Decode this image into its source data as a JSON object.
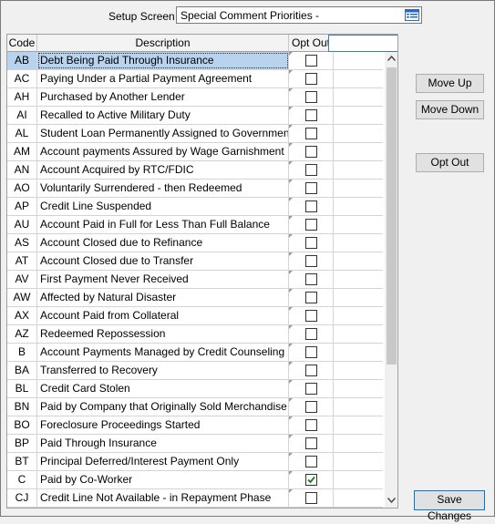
{
  "setup": {
    "label": "Setup Screen",
    "value": "Special Comment Priorities -"
  },
  "grid": {
    "headers": {
      "code": "Code",
      "description": "Description",
      "opt_out": "Opt Out"
    },
    "rows": [
      {
        "code": "AB",
        "description": "Debt Being Paid Through Insurance",
        "opt_out": false,
        "selected": true
      },
      {
        "code": "AC",
        "description": "Paying Under a Partial Payment Agreement",
        "opt_out": false
      },
      {
        "code": "AH",
        "description": "Purchased by Another Lender",
        "opt_out": false
      },
      {
        "code": "AI",
        "description": "Recalled to Active Military Duty",
        "opt_out": false
      },
      {
        "code": "AL",
        "description": "Student Loan Permanently Assigned to Government",
        "opt_out": false
      },
      {
        "code": "AM",
        "description": "Account payments Assured by Wage Garnishment",
        "opt_out": false
      },
      {
        "code": "AN",
        "description": "Account Acquired by RTC/FDIC",
        "opt_out": false
      },
      {
        "code": "AO",
        "description": "Voluntarily Surrendered - then Redeemed",
        "opt_out": false
      },
      {
        "code": "AP",
        "description": "Credit Line Suspended",
        "opt_out": false
      },
      {
        "code": "AU",
        "description": "Account Paid in Full for Less Than Full Balance",
        "opt_out": false
      },
      {
        "code": "AS",
        "description": "Account Closed due to Refinance",
        "opt_out": false
      },
      {
        "code": "AT",
        "description": "Account Closed due to Transfer",
        "opt_out": false
      },
      {
        "code": "AV",
        "description": "First Payment Never Received",
        "opt_out": false
      },
      {
        "code": "AW",
        "description": "Affected by Natural Disaster",
        "opt_out": false
      },
      {
        "code": "AX",
        "description": "Account Paid from Collateral",
        "opt_out": false
      },
      {
        "code": "AZ",
        "description": "Redeemed Repossession",
        "opt_out": false
      },
      {
        "code": "B",
        "description": "Account Payments Managed by Credit Counseling",
        "opt_out": false
      },
      {
        "code": "BA",
        "description": "Transferred to Recovery",
        "opt_out": false
      },
      {
        "code": "BL",
        "description": "Credit Card Stolen",
        "opt_out": false
      },
      {
        "code": "BN",
        "description": "Paid by Company that Originally Sold Merchandise",
        "opt_out": false
      },
      {
        "code": "BO",
        "description": "Foreclosure Proceedings Started",
        "opt_out": false
      },
      {
        "code": "BP",
        "description": "Paid Through Insurance",
        "opt_out": false
      },
      {
        "code": "BT",
        "description": "Principal Deferred/Interest Payment Only",
        "opt_out": false
      },
      {
        "code": "C",
        "description": "Paid by Co-Worker",
        "opt_out": true
      },
      {
        "code": "CJ",
        "description": "Credit Line Not Available - in Repayment Phase",
        "opt_out": false
      }
    ]
  },
  "buttons": {
    "move_up": "Move Up",
    "move_down": "Move Down",
    "opt_out": "Opt Out",
    "save": "Save Changes"
  },
  "colors": {
    "selection": "#b8d3ee",
    "check": "#1a7a1a",
    "focus_border": "#0078d7"
  },
  "icons": {
    "setup_picker": "list-picker-icon",
    "scroll_up": "chevron-up-icon",
    "scroll_down": "chevron-down-icon"
  }
}
